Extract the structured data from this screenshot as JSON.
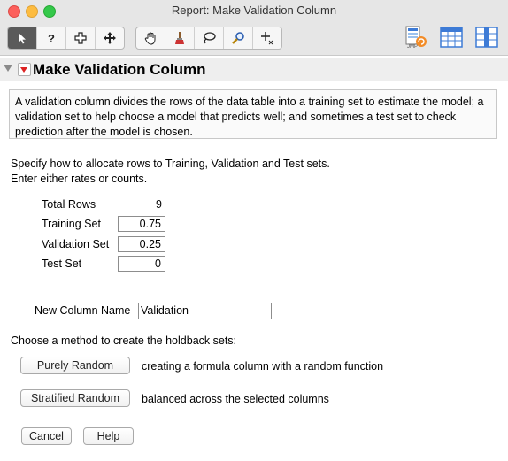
{
  "window": {
    "title": "Report: Make Validation Column"
  },
  "toolbar": {
    "left_tools": [
      {
        "name": "arrow-tool",
        "icon": "arrow-icon"
      },
      {
        "name": "help-tool",
        "icon": "question-icon",
        "glyph": "?"
      },
      {
        "name": "selection-tool",
        "icon": "plus-cross-icon"
      },
      {
        "name": "scroller-tool",
        "icon": "move-arrows-icon"
      }
    ],
    "mid_tools": [
      {
        "name": "grabber-tool",
        "icon": "hand-icon"
      },
      {
        "name": "brush-tool",
        "icon": "brush-icon"
      },
      {
        "name": "lasso-tool",
        "icon": "lasso-icon"
      },
      {
        "name": "magnifier-tool",
        "icon": "magnifier-icon"
      },
      {
        "name": "crosshair-tool",
        "icon": "crosshair-icon"
      }
    ],
    "right_tools": [
      {
        "name": "jmp-home-tool",
        "icon": "jmp-home-icon"
      },
      {
        "name": "data-table-tool",
        "icon": "data-table-icon"
      },
      {
        "name": "column-tool",
        "icon": "column-icon"
      }
    ]
  },
  "report": {
    "title": "Make Validation Column",
    "description": "A validation column divides the rows of the data table into a training set to estimate the model; a validation set to help choose a model that predicts well; and sometimes a test set to check prediction after the model is chosen.",
    "instructions_line1": "Specify how to allocate rows to Training, Validation and Test sets.",
    "instructions_line2": "Enter either rates or counts.",
    "total_rows_label": "Total Rows",
    "total_rows_value": "9",
    "training_label": "Training Set",
    "training_value": "0.75",
    "validation_label": "Validation Set",
    "validation_value": "0.25",
    "test_label": "Test Set",
    "test_value": "0",
    "new_column_label": "New Column Name",
    "new_column_value": "Validation",
    "method_title": "Choose a method to create the holdback sets:",
    "purely_random_label": "Purely Random",
    "purely_random_desc": "creating a formula column with a random function",
    "stratified_random_label": "Stratified Random",
    "stratified_random_desc": "balanced across the selected columns",
    "cancel_label": "Cancel",
    "help_label": "Help"
  },
  "colors": {
    "red_triangle": "#dd2222",
    "active_tool": "#5a5a5a"
  }
}
